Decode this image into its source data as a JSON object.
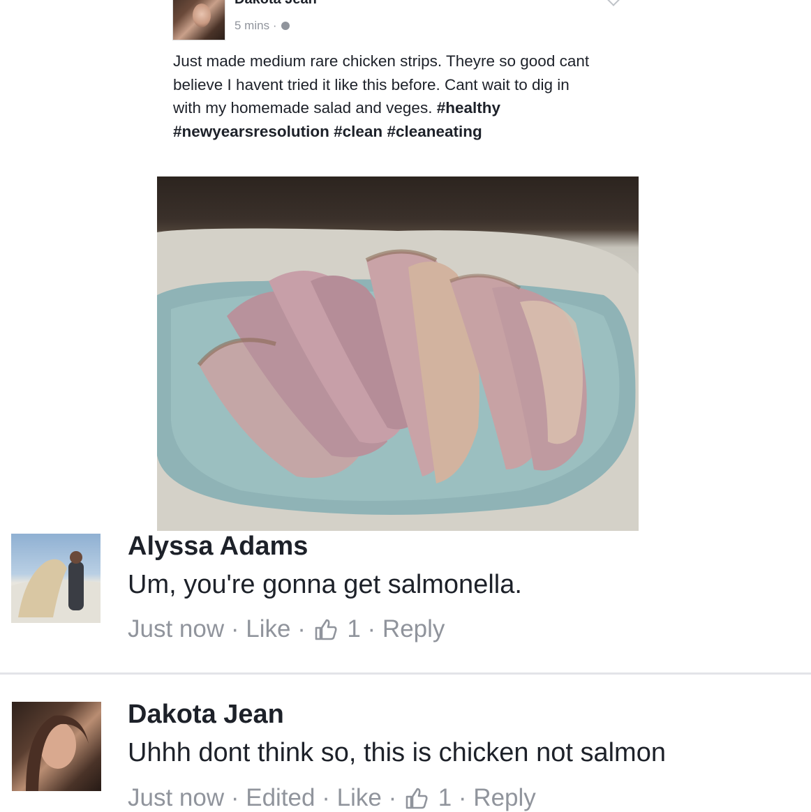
{
  "post": {
    "author": "Dakota Jean",
    "time": "5 mins",
    "separator": "·",
    "text": "Just made medium rare chicken strips. Theyre so good cant believe I havent tried it like this before. Cant wait to dig in with my homemade salad and veges.",
    "hashtags": [
      "#healthy",
      "#newyearsresolution",
      "#clean",
      "#cleaneating"
    ]
  },
  "comments": [
    {
      "author": "Alyssa Adams",
      "text": "Um, you're gonna get salmonella.",
      "time": "Just now",
      "like_label": "Like",
      "like_count": "1",
      "reply_label": "Reply"
    },
    {
      "author": "Dakota Jean",
      "text": "Uhhh dont think so, this is chicken not salmon",
      "time": "Just now",
      "edited_label": "Edited",
      "like_label": "Like",
      "like_count": "1",
      "reply_label": "Reply"
    }
  ],
  "icons": {
    "post_privacy": "globe-icon",
    "post_options": "chevron-down-icon",
    "comment_like_count": "thumbs-up-icon"
  },
  "colors": {
    "text_primary": "#1d2129",
    "text_secondary": "#90949c",
    "divider": "#e3e4e8"
  }
}
